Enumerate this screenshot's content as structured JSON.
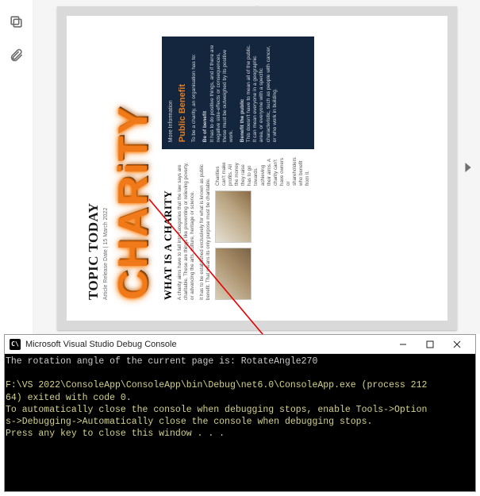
{
  "document": {
    "topic_header": "TOPIC TODAY",
    "release_line": "Article Release Date | 15 March 2022",
    "charity_word": "CHARiTY",
    "what_header": "WHAT IS A CHARITY",
    "para1": "A charity aims have to fall into categories that the law says are charitable. These are things like preventing or relieving poverty, or advancing the arts, culture, heritage or science.",
    "para2": "It has to be established exclusively for what is known as public benefit. That means its only purpose must be charitable.",
    "para3": "Charities can't make profits. All the money they raise has to go towards achieving their aims. A charity can't have owners or shareholders who benefit from it.",
    "panel_more": "More Information",
    "panel_title": "Public Benefit",
    "panel_sub": "To be a charity, an organisation has to:",
    "panel_b1h": "Be of benefit",
    "panel_b1": "It has to do positive things, and if there are negative side-effects or consequences, these must be outweighed by its positive work.",
    "panel_b2h": "Benefit the public",
    "panel_b2": "This doesn't have to mean all of the public. It can mean everyone in a geographic area, or everyone with a specific characteristic, such as people with cancer, or who work in building."
  },
  "console": {
    "window_title": "Microsoft Visual Studio Debug Console",
    "line1": "The rotation angle of the current page is: RotateAngle270",
    "line2": "",
    "line3a": "F:\\VS 2022\\ConsoleApp\\ConsoleApp\\bin\\Debug\\net6.0\\ConsoleApp.exe (process 212",
    "line3b": "64) exited with code 0.",
    "line4a": "To automatically close the console when debugging stops, enable Tools->Option",
    "line4b": "s->Debugging->Automatically close the console when debugging stops.",
    "line5": "Press any key to close this window . . ."
  },
  "icons": {
    "copy": "copy-icon",
    "attach": "attachment-icon"
  }
}
